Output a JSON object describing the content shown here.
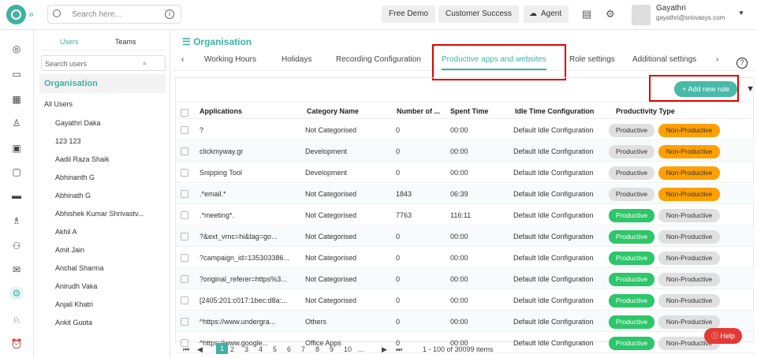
{
  "topbar": {
    "search_placeholder": "Search here...",
    "buttons": [
      "Free Demo",
      "Customer Success",
      "Agent"
    ],
    "user_name": "Gayathri",
    "user_email": "gayathri@sriovasys.com"
  },
  "sidebar": {
    "tabs": [
      "Users",
      "Teams"
    ],
    "search_placeholder": "Search users",
    "org": "Organisation",
    "items": [
      "All Users",
      "Gayathri Daka",
      "123 123",
      "Aadil Raza Shaik",
      "Abhinanth G",
      "Abhinath G",
      "Abhishek Kumar Shrivastv...",
      "Akhil A",
      "Amit Jain",
      "Anchal Sharma",
      "Anirudh Vaka",
      "Anjali Khatri",
      "Ankit Gupta"
    ]
  },
  "main": {
    "title": "Organisation",
    "tabs": [
      "Working Hours",
      "Holidays",
      "Recording Configuration",
      "Productive apps and websites",
      "Role settings",
      "Additional settings"
    ],
    "add_rule": "Add new rule",
    "columns": [
      "Applications",
      "Category Name",
      "Number of ...",
      "Spent Time",
      "Idle Time Configuration",
      "Productivity Type"
    ],
    "rows": [
      {
        "app": "?",
        "cat": "Not Categorised",
        "num": "0",
        "time": "00:00",
        "idle": "Default Idle Configuration",
        "type": "non"
      },
      {
        "app": "clickmyway.gr",
        "cat": "Development",
        "num": "0",
        "time": "00:00",
        "idle": "Default Idle Configuration",
        "type": "non"
      },
      {
        "app": "Snipping Tool",
        "cat": "Development",
        "num": "0",
        "time": "00:00",
        "idle": "Default Idle Configuration",
        "type": "non"
      },
      {
        "app": ".*email.*",
        "cat": "Not Categorised",
        "num": "1843",
        "time": "06:39",
        "idle": "Default Idle Configuration",
        "type": "non"
      },
      {
        "app": ".*meeting*.",
        "cat": "Not Categorised",
        "num": "7763",
        "time": "116:11",
        "idle": "Default Idle Configuration",
        "type": "pro"
      },
      {
        "app": "?&ext_vrnc=hi&tag=go...",
        "cat": "Not Categorised",
        "num": "0",
        "time": "00:00",
        "idle": "Default Idle Configuration",
        "type": "pro"
      },
      {
        "app": "?campaign_id=135303386...",
        "cat": "Not Categorised",
        "num": "0",
        "time": "00:00",
        "idle": "Default Idle Configuration",
        "type": "pro"
      },
      {
        "app": "?original_referer=https%3...",
        "cat": "Not Categorised",
        "num": "0",
        "time": "00:00",
        "idle": "Default Idle Configuration",
        "type": "pro"
      },
      {
        "app": "[2405:201:c017:1bec:d8a:...",
        "cat": "Not Categorised",
        "num": "0",
        "time": "00:00",
        "idle": "Default Idle Configuration",
        "type": "pro"
      },
      {
        "app": "^https://www.undergra...",
        "cat": "Others",
        "num": "0",
        "time": "00:00",
        "idle": "Default Idle Configuration",
        "type": "pro"
      },
      {
        "app": "^https://www.google...",
        "cat": "Office Apps",
        "num": "0",
        "time": "00:00",
        "idle": "Default Idle Configuration",
        "type": "pro"
      }
    ],
    "productive_label": "Productive",
    "nonproductive_label": "Non-Productive",
    "pages": [
      "1",
      "2",
      "3",
      "4",
      "5",
      "6",
      "7",
      "8",
      "9",
      "10",
      "..."
    ],
    "range_text": "1 - 100 of 30099 items",
    "help": "Help",
    "colors": {
      "accent": "#3fb2a4",
      "green": "#2ec66a",
      "orange": "#ffa000",
      "gray": "#e0e0e0",
      "red": "#e00000"
    }
  }
}
